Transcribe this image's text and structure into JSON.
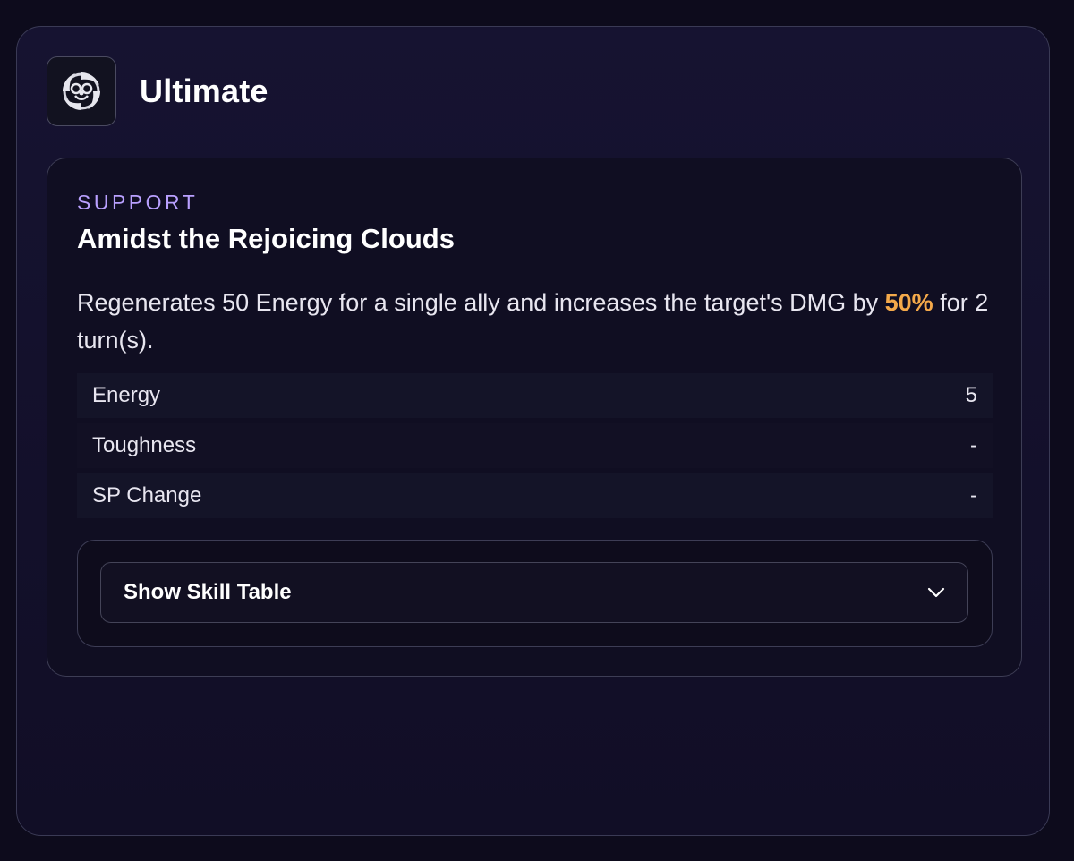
{
  "header": {
    "title": "Ultimate",
    "icon": "ultimate-skill-emblem-icon"
  },
  "skill": {
    "category": "SUPPORT",
    "name": "Amidst the Rejoicing Clouds",
    "description_before": "Regenerates 50 Energy for a single ally and increases the target's DMG by ",
    "description_highlight": "50%",
    "description_after": " for 2 turn(s)."
  },
  "stats": [
    {
      "label": "Energy",
      "value": "5"
    },
    {
      "label": "Toughness",
      "value": "-"
    },
    {
      "label": "SP Change",
      "value": "-"
    }
  ],
  "expander": {
    "label": "Show Skill Table",
    "icon": "chevron-down-icon"
  },
  "colors": {
    "accent_purple": "#b9a0ff",
    "highlight_orange": "#f4a94a",
    "background": "#0d0b1c"
  }
}
